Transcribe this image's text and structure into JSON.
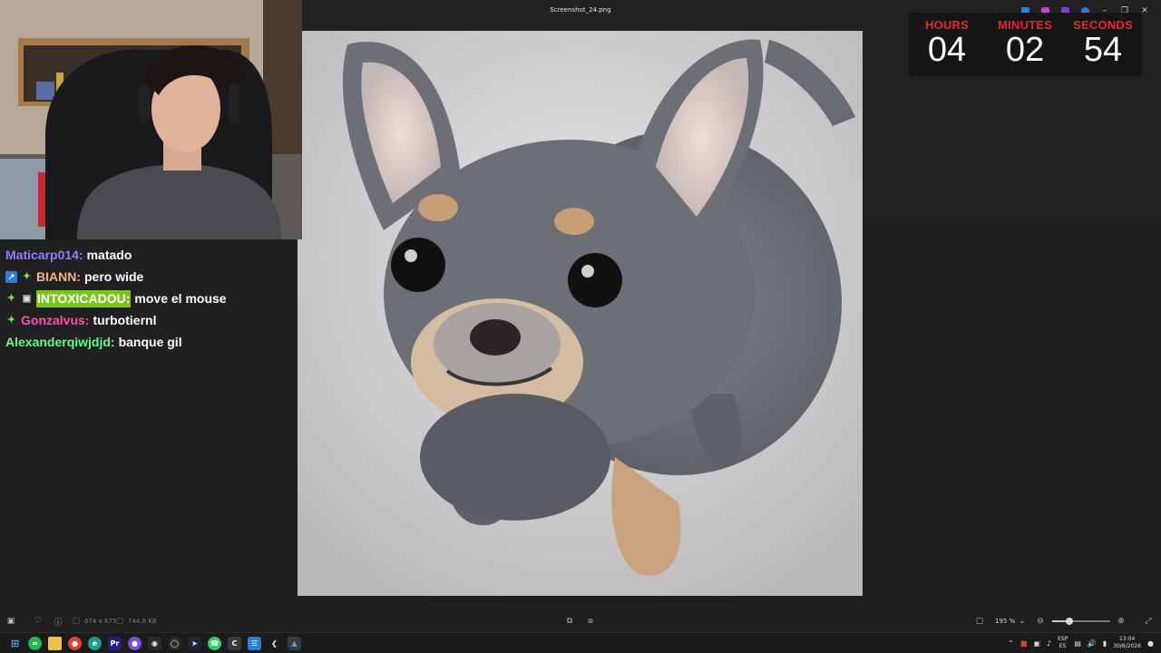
{
  "window": {
    "title": "Screenshot_24.png"
  },
  "timer": {
    "hours_label": "HOURS",
    "minutes_label": "MINUTES",
    "seconds_label": "SECONDS",
    "hours": "04",
    "minutes": "02",
    "seconds": "54",
    "label_color": "#e8242e"
  },
  "chat": {
    "messages": [
      {
        "user": "Maticarp014:",
        "user_color": "#8f7fff",
        "text": "matado",
        "badges": []
      },
      {
        "user": "BIANN:",
        "user_color": "#ffb27a",
        "text": "pero wide",
        "badges": [
          "pencil-badge-icon",
          "sparkle-badge-icon"
        ]
      },
      {
        "user": "INTOXICADOU:",
        "user_color": "#ffffff",
        "text": "move el mouse",
        "badges": [
          "sparkle-badge-icon",
          "cat-badge-icon"
        ],
        "highlighted": true
      },
      {
        "user": "Gonzalvus:",
        "user_color": "#ff4fb0",
        "text": "turbotiernl",
        "badges": [
          "sparkle-badge-icon"
        ]
      },
      {
        "user": "Alexanderqiwjdjd:",
        "user_color": "#5bff8a",
        "text": "banque gil",
        "badges": []
      }
    ]
  },
  "image_info": {
    "dimensions": "674 x 675",
    "filesize": "744.8 KB"
  },
  "zoom": {
    "value": "195 %",
    "level": 0.3
  },
  "tray": {
    "lang_top": "ESP",
    "lang_bottom": "ES",
    "time": "13:04",
    "date": "30/6/2026"
  }
}
